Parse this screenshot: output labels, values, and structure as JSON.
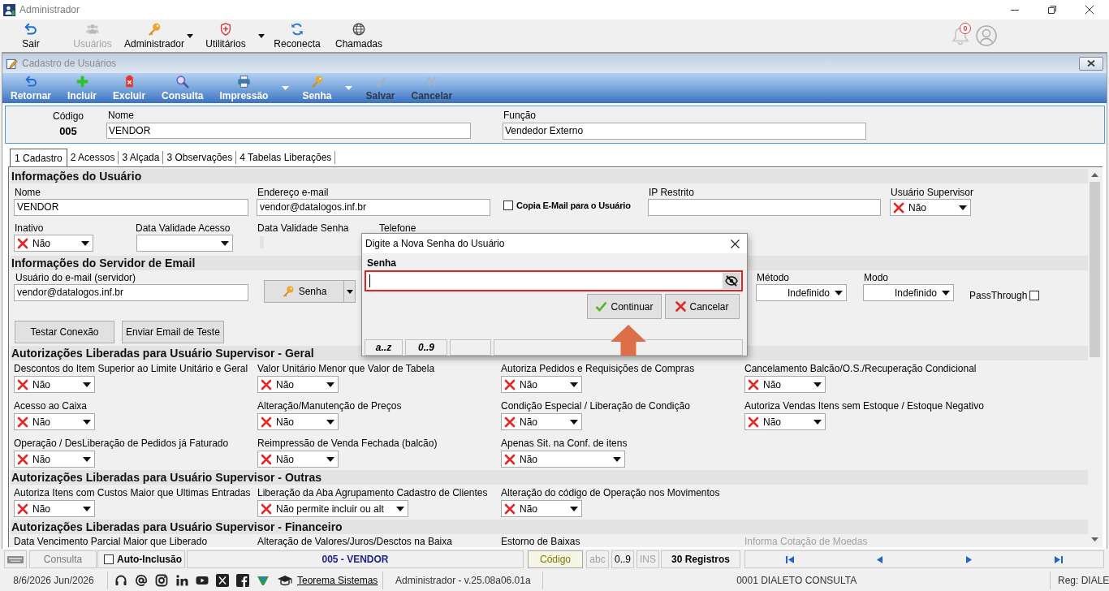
{
  "window": {
    "title": "Administrador"
  },
  "main_toolbar": [
    {
      "label": "Sair",
      "disabled": false,
      "dropdown": false
    },
    {
      "label": "Usuários",
      "disabled": true,
      "dropdown": false
    },
    {
      "label": "Administrador",
      "disabled": false,
      "dropdown": true
    },
    {
      "label": "Utilitários",
      "disabled": false,
      "dropdown": true
    },
    {
      "label": "Reconecta",
      "disabled": false,
      "dropdown": false
    },
    {
      "label": "Chamadas",
      "disabled": false,
      "dropdown": false
    }
  ],
  "notifications": {
    "count": "0"
  },
  "form_window": {
    "title": "Cadastro de Usuários"
  },
  "form_toolbar": [
    {
      "label": "Retornar",
      "disabled": false,
      "dropdown": false
    },
    {
      "label": "Incluir",
      "disabled": false,
      "dropdown": false
    },
    {
      "label": "Excluir",
      "disabled": false,
      "dropdown": false
    },
    {
      "label": "Consulta",
      "disabled": false,
      "dropdown": false
    },
    {
      "label": "Impressão",
      "disabled": false,
      "dropdown": true
    },
    {
      "label": "Senha",
      "disabled": false,
      "dropdown": true
    },
    {
      "label": "Salvar",
      "disabled": true,
      "dropdown": false
    },
    {
      "label": "Cancelar",
      "disabled": true,
      "dropdown": false
    }
  ],
  "header": {
    "code": {
      "label": "Código",
      "value": "005"
    },
    "name": {
      "label": "Nome",
      "value": "VENDOR"
    },
    "function": {
      "label": "Função",
      "value": "Vendedor Externo"
    }
  },
  "tabs": [
    {
      "label": "1 Cadastro",
      "selected": true
    },
    {
      "label": "2 Acessos",
      "selected": false
    },
    {
      "label": "3 Alçada",
      "selected": false
    },
    {
      "label": "3 Observações",
      "selected": false
    },
    {
      "label": "4 Tabelas Liberações",
      "selected": false
    }
  ],
  "user_info": {
    "title": "Informações do Usuário",
    "name": {
      "label": "Nome",
      "value": "VENDOR"
    },
    "email": {
      "label": "Endereço e-mail",
      "value": "vendor@datalogos.inf.br"
    },
    "copy_email": {
      "label": "Copia E-Mail para o Usuário",
      "checked": false
    },
    "restricted_ip": {
      "label": "IP Restrito"
    },
    "supervisor": {
      "label": "Usuário Supervisor",
      "value": "Não"
    },
    "inactive": {
      "label": "Inativo",
      "value": "Não"
    },
    "access_expiry": {
      "label": "Data Validade Acesso"
    },
    "password_expiry": {
      "label": "Data Validade Senha"
    },
    "phone": {
      "label": "Telefone"
    }
  },
  "email_server": {
    "title": "Informações do Servidor de Email",
    "user": {
      "label": "Usuário do e-mail (servidor)",
      "value": "vendor@datalogos.inf.br"
    },
    "password_button": "Senha",
    "method": {
      "label": "Método",
      "value": "Indefinido"
    },
    "mode": {
      "label": "Modo",
      "value": "Indefinido"
    },
    "passthrough": {
      "label": "PassThrough",
      "checked": false
    },
    "buttons": [
      "Testar Conexão",
      "Enviar Email de Teste"
    ]
  },
  "permission_sections": [
    {
      "title": "Autorizações Liberadas para Usuário Supervisor - Geral",
      "items": [
        {
          "label": "Descontos do Item Superior ao Limite Unitário e Geral",
          "value": "Não",
          "disabled": false
        },
        {
          "label": "Valor Unitário Menor que Valor de Tabela",
          "value": "Não",
          "disabled": false
        },
        {
          "label": "Autoriza Pedidos e Requisições de Compras",
          "value": "Não",
          "disabled": false
        },
        {
          "label": "Cancelamento Balcão/O.S./Recuperação Condicional",
          "value": "Não",
          "disabled": false
        },
        {
          "label": "Acesso ao Caixa",
          "value": "Não",
          "disabled": false
        },
        {
          "label": "Alteração/Manutenção de Preços",
          "value": "Não",
          "disabled": false
        },
        {
          "label": "Condição Especial / Liberação de Condição",
          "value": "Não",
          "disabled": false
        },
        {
          "label": "Autoriza Vendas Itens sem Estoque / Estoque Negativo",
          "value": "Não",
          "disabled": false
        },
        {
          "label": "Operação / DesLiberação de Pedidos já Faturado",
          "value": "Não",
          "disabled": false
        },
        {
          "label": "Reimpressão de Venda Fechada (balcão)",
          "value": "Não",
          "disabled": false
        },
        {
          "label": "Apenas Sit. na Conf. de itens",
          "value": "Não",
          "disabled": false
        }
      ]
    },
    {
      "title": "Autorizações Liberadas para Usuário Supervisor - Outras",
      "items": [
        {
          "label": "Autoriza Itens com Custos Maior que Ultimas Entradas",
          "value": "Não",
          "disabled": false
        },
        {
          "label": "Liberação da Aba Agrupamento Cadastro de Clientes",
          "value": "Não permite incluir ou alt",
          "disabled": false
        },
        {
          "label": "Alteração do código de Operação nos Movimentos",
          "value": "Não",
          "disabled": false
        }
      ]
    },
    {
      "title": "Autorizações Liberadas para Usuário Supervisor - Financeiro",
      "items": [
        {
          "label": "Data Vencimento Parcial Maior que Liberado",
          "disabled": false
        },
        {
          "label": "Alteração de Valores/Juros/Desctos na Baixa",
          "disabled": false
        },
        {
          "label": "Estorno de Baixas",
          "disabled": false
        },
        {
          "label": "Informa Cotação de Moedas",
          "disabled": true
        }
      ]
    }
  ],
  "password_dialog": {
    "title": "Digite a Nova Senha do Usuário",
    "label": "Senha",
    "buttons": [
      {
        "label": "Continuar",
        "kind": "confirm"
      },
      {
        "label": "Cancelar",
        "kind": "cancel"
      }
    ],
    "status": [
      "a..z",
      "0..9"
    ]
  },
  "record_bar": {
    "mode": "Consulta",
    "auto_insert": {
      "label": "Auto-Inclusão",
      "checked": false
    },
    "record": "005 - VENDOR",
    "order": "Código",
    "indicators": [
      {
        "label": "abc",
        "on": false
      },
      {
        "label": "0..9",
        "on": true
      },
      {
        "label": "INS",
        "on": false
      }
    ],
    "count": "30 Registros"
  },
  "status_bar": {
    "date": "8/6/2026 Jun/2026",
    "link": "Teorema Sistemas",
    "version": "Administrador - v.25.08a06.01a",
    "company": "0001 DIALETO CONSULTA",
    "registration": "Reg: DIALE"
  }
}
